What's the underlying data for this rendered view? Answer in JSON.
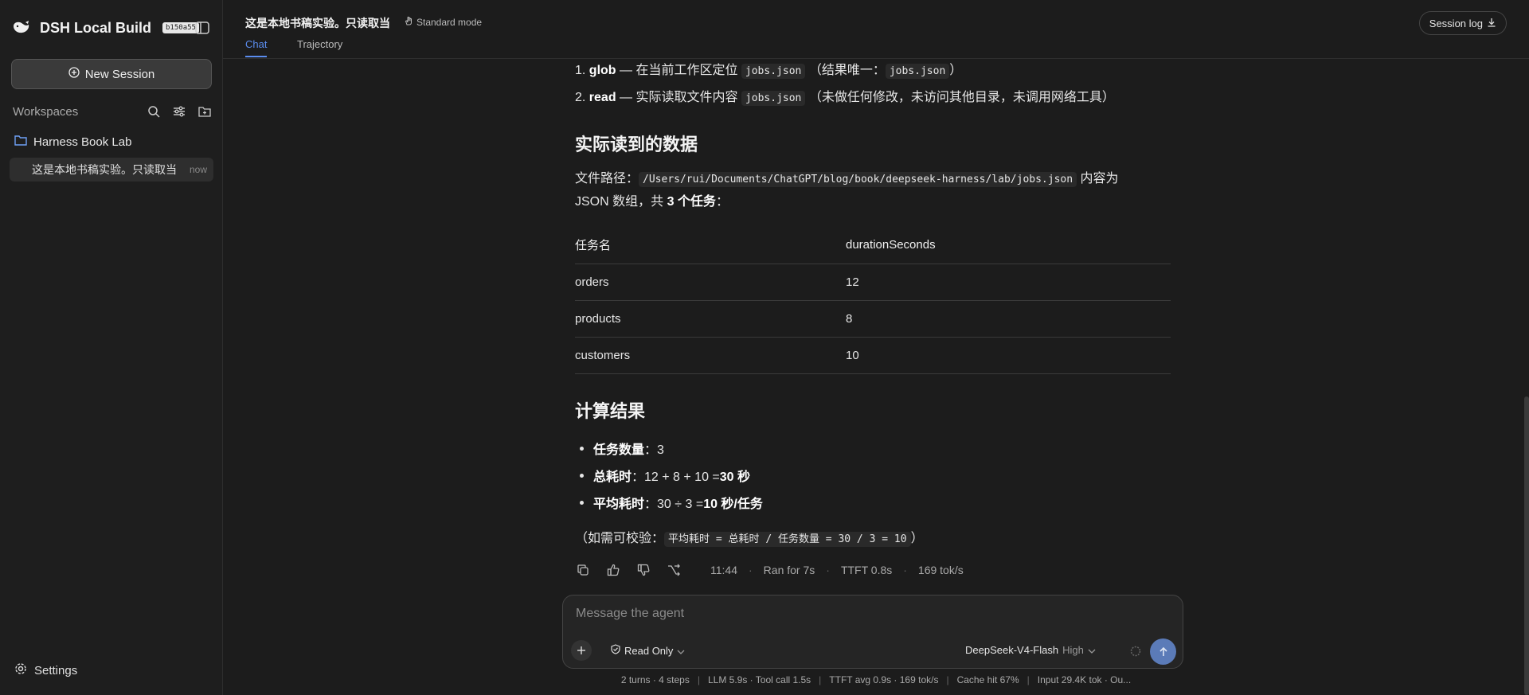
{
  "sidebar": {
    "brand": "DSH Local Build",
    "build": "b150a55",
    "new_session": "New Session",
    "workspaces_label": "Workspaces",
    "workspace_name": "Harness Book Lab",
    "session_title": "这是本地书稿实验。只读取当",
    "session_time": "now",
    "settings": "Settings"
  },
  "header": {
    "title": "这是本地书稿实验。只读取当",
    "mode": "Standard mode",
    "tabs": [
      "Chat",
      "Trajectory"
    ],
    "session_log": "Session log"
  },
  "content": {
    "steps": [
      {
        "num": "1.",
        "tool": "glob",
        "text": " — 在当前工作区定位 ",
        "code": "jobs.json",
        "tail_pre": "（结果唯一：",
        "tail_code": "jobs.json",
        "tail_post": "）"
      },
      {
        "num": "2.",
        "tool": "read",
        "text": " — 实际读取文件内容 ",
        "code": "jobs.json",
        "tail": "（未做任何修改，未访问其他目录，未调用网络工具）"
      }
    ],
    "section1_title": "实际读到的数据",
    "path_prefix": "文件路径：",
    "path": "/Users/rui/Documents/ChatGPT/blog/book/deepseek-harness/lab/jobs.json",
    "path_suffix": " 内容为",
    "path_line2_pre": "JSON 数组，共 ",
    "path_line2_bold": "3 个任务",
    "path_line2_post": "：",
    "table": {
      "headers": [
        "任务名",
        "durationSeconds"
      ],
      "rows": [
        [
          "orders",
          "12"
        ],
        [
          "products",
          "8"
        ],
        [
          "customers",
          "10"
        ]
      ]
    },
    "section2_title": "计算结果",
    "bullets": [
      {
        "label": "任务数量",
        "value": "：3",
        "bold": ""
      },
      {
        "label": "总耗时",
        "value": "：12 + 8 + 10 = ",
        "bold": "30 秒"
      },
      {
        "label": "平均耗时",
        "value": "：30 ÷ 3 = ",
        "bold": "10 秒/任务"
      }
    ],
    "verify_pre": "（如需可校验：",
    "verify_code": "平均耗时 = 总耗时 / 任务数量 = 30 / 3 = 10",
    "verify_post": "）",
    "meta": {
      "time": "11:44",
      "ran": "Ran for 7s",
      "ttft": "TTFT 0.8s",
      "speed": "169 tok/s"
    }
  },
  "composer": {
    "placeholder": "Message the agent",
    "mode": "Read Only",
    "model": "DeepSeek-V4-Flash",
    "level": "High"
  },
  "statusbar": {
    "items": [
      "2 turns · 4 steps",
      "LLM 5.9s · Tool call 1.5s",
      "TTFT avg 0.9s · 169 tok/s",
      "Cache hit 67%",
      "Input 29.4K tok · Ou..."
    ]
  },
  "colors": {
    "accent": "#5b8def",
    "background": "#1c1c1c",
    "send": "#5b7bb8"
  }
}
